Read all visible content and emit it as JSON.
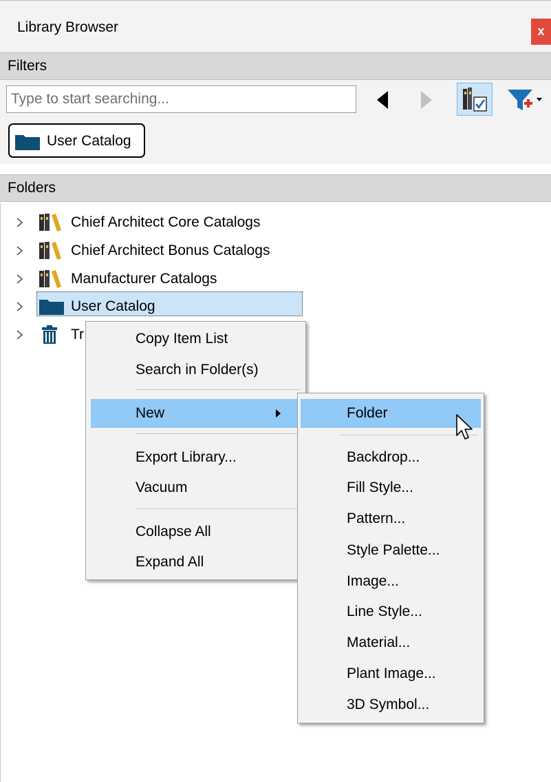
{
  "window": {
    "title": "Library Browser",
    "close_label": "x"
  },
  "filters": {
    "header": "Filters",
    "search_placeholder": "Type to start searching...",
    "search_value": "",
    "active_chip": "User Catalog"
  },
  "folders": {
    "header": "Folders",
    "items": [
      {
        "label": "Chief Architect Core Catalogs",
        "icon": "catalog-books-icon"
      },
      {
        "label": "Chief Architect Bonus Catalogs",
        "icon": "catalog-books-icon"
      },
      {
        "label": "Manufacturer Catalogs",
        "icon": "catalog-books-icon"
      },
      {
        "label": "User Catalog",
        "icon": "folder-icon",
        "selected": true
      },
      {
        "label": "Tr",
        "icon": "trash-icon"
      }
    ]
  },
  "context_menu": {
    "items": [
      "Copy Item List",
      "Search in Folder(s)",
      "New",
      "Export Library...",
      "Vacuum",
      "Collapse All",
      "Expand All"
    ],
    "highlighted": "New"
  },
  "submenu": {
    "items": [
      "Folder",
      "Backdrop...",
      "Fill Style...",
      "Pattern...",
      "Style Palette...",
      "Image...",
      "Line Style...",
      "Material...",
      "Plant Image...",
      "3D Symbol..."
    ],
    "highlighted": "Folder"
  },
  "colors": {
    "highlight": "#91c9f7",
    "selection": "#cce4f7",
    "close": "#e04a3b",
    "folder": "#0e4f73"
  }
}
